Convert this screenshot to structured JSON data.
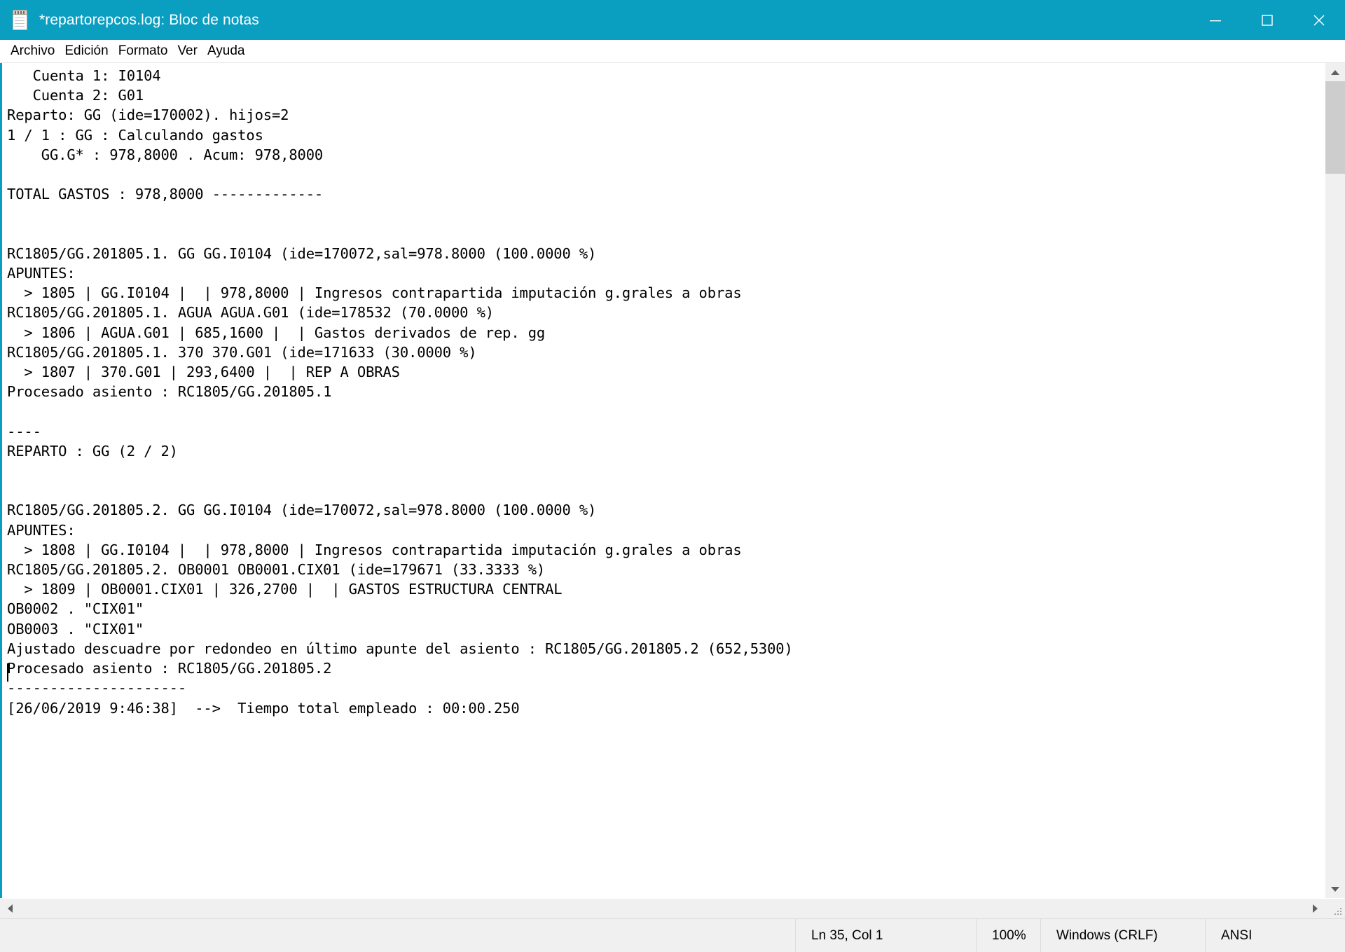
{
  "window": {
    "title": "*repartorepcos.log: Bloc de notas",
    "icon": "notepad-icon",
    "accent_color": "#0a9ec1",
    "buttons": {
      "minimize": "minimize",
      "maximize": "maximize",
      "close": "close"
    }
  },
  "menubar": {
    "items": [
      {
        "label": "Archivo"
      },
      {
        "label": "Edición"
      },
      {
        "label": "Formato"
      },
      {
        "label": "Ver"
      },
      {
        "label": "Ayuda"
      }
    ]
  },
  "editor": {
    "text": "   Cuenta 1: I0104\n   Cuenta 2: G01\nReparto: GG (ide=170002). hijos=2\n1 / 1 : GG : Calculando gastos\n    GG.G* : 978,8000 . Acum: 978,8000\n\nTOTAL GASTOS : 978,8000 -------------\n\n\nRC1805/GG.201805.1. GG GG.I0104 (ide=170072,sal=978.8000 (100.0000 %)\nAPUNTES:\n  > 1805 | GG.I0104 |  | 978,8000 | Ingresos contrapartida imputación g.grales a obras\nRC1805/GG.201805.1. AGUA AGUA.G01 (ide=178532 (70.0000 %)\n  > 1806 | AGUA.G01 | 685,1600 |  | Gastos derivados de rep. gg\nRC1805/GG.201805.1. 370 370.G01 (ide=171633 (30.0000 %)\n  > 1807 | 370.G01 | 293,6400 |  | REP A OBRAS\nProcesado asiento : RC1805/GG.201805.1\n\n----\nREPARTO : GG (2 / 2)\n\n\nRC1805/GG.201805.2. GG GG.I0104 (ide=170072,sal=978.8000 (100.0000 %)\nAPUNTES:\n  > 1808 | GG.I0104 |  | 978,8000 | Ingresos contrapartida imputación g.grales a obras\nRC1805/GG.201805.2. OB0001 OB0001.CIX01 (ide=179671 (33.3333 %)\n  > 1809 | OB0001.CIX01 | 326,2700 |  | GASTOS ESTRUCTURA CENTRAL\nOB0002 . \"CIX01\"\nOB0003 . \"CIX01\"\nAjustado descuadre por redondeo en último apunte del asiento : RC1805/GG.201805.2 (652,5300)\nProcesado asiento : RC1805/GG.201805.2\n---------------------\n[26/06/2019 9:46:38]  -->  Tiempo total empleado : 00:00.250\n"
  },
  "scrollbars": {
    "vertical": {
      "up_arrow": "scroll-up-arrow",
      "down_arrow": "scroll-down-arrow"
    },
    "horizontal": {
      "left_arrow": "scroll-left-arrow",
      "right_arrow": "scroll-right-arrow"
    }
  },
  "statusbar": {
    "position": "Ln 35, Col 1",
    "zoom": "100%",
    "line_endings": "Windows (CRLF)",
    "encoding": "ANSI"
  }
}
